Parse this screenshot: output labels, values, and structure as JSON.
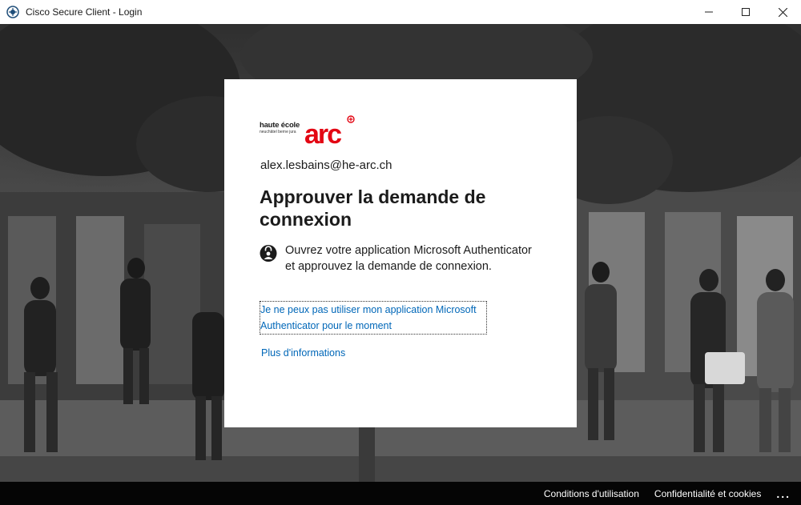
{
  "window": {
    "title": "Cisco Secure Client - Login",
    "controls": [
      "minimize-icon",
      "maximize-icon",
      "close-icon"
    ]
  },
  "logo": {
    "line1": "haute école",
    "line2": "neuchâtel berne jura",
    "mark": "arc",
    "brand_color": "#e30613"
  },
  "signin": {
    "email": "alex.lesbains@he-arc.ch",
    "heading": "Approuver la demande de connexion",
    "instruction": "Ouvrez votre application Microsoft Authenticator et approuvez la demande de connexion.",
    "instruction_icon": "authenticator-lock-icon",
    "alt_link": "Je ne peux pas utiliser mon application Microsoft Authenticator pour le moment",
    "more_info_link": "Plus d'informations"
  },
  "footer": {
    "terms": "Conditions d'utilisation",
    "privacy": "Confidentialité et cookies",
    "more": "..."
  },
  "colors": {
    "link": "#0067b8",
    "text": "#1b1b1b",
    "footer_bg": "#000000"
  }
}
